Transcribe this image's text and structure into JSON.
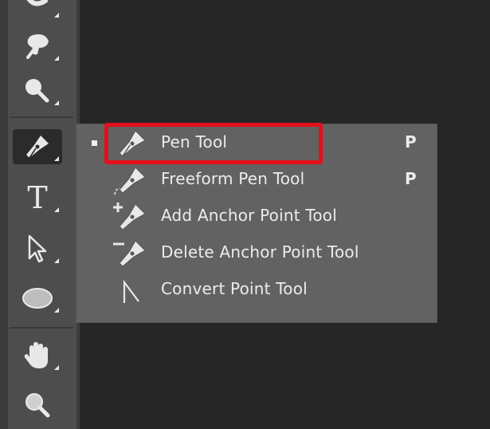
{
  "toolbar": {
    "tools": [
      {
        "name": "spot-healing-brush-icon"
      },
      {
        "name": "history-brush-icon"
      },
      {
        "name": "dodge-icon"
      },
      {
        "name": "pen-icon",
        "active": true
      },
      {
        "name": "type-icon",
        "glyph": "T"
      },
      {
        "name": "path-selection-icon"
      },
      {
        "name": "ellipse-icon"
      },
      {
        "name": "hand-icon"
      },
      {
        "name": "zoom-icon"
      }
    ]
  },
  "menu": {
    "items": [
      {
        "label": "Pen Tool",
        "shortcut": "P",
        "selected": true,
        "icon": "pen-icon"
      },
      {
        "label": "Freeform Pen Tool",
        "shortcut": "P",
        "icon": "freeform-pen-icon"
      },
      {
        "label": "Add Anchor Point Tool",
        "shortcut": "",
        "icon": "add-anchor-point-icon"
      },
      {
        "label": "Delete Anchor Point Tool",
        "shortcut": "",
        "icon": "delete-anchor-point-icon"
      },
      {
        "label": "Convert Point Tool",
        "shortcut": "",
        "icon": "convert-point-icon"
      }
    ],
    "highlight_color": "#e3101c"
  }
}
